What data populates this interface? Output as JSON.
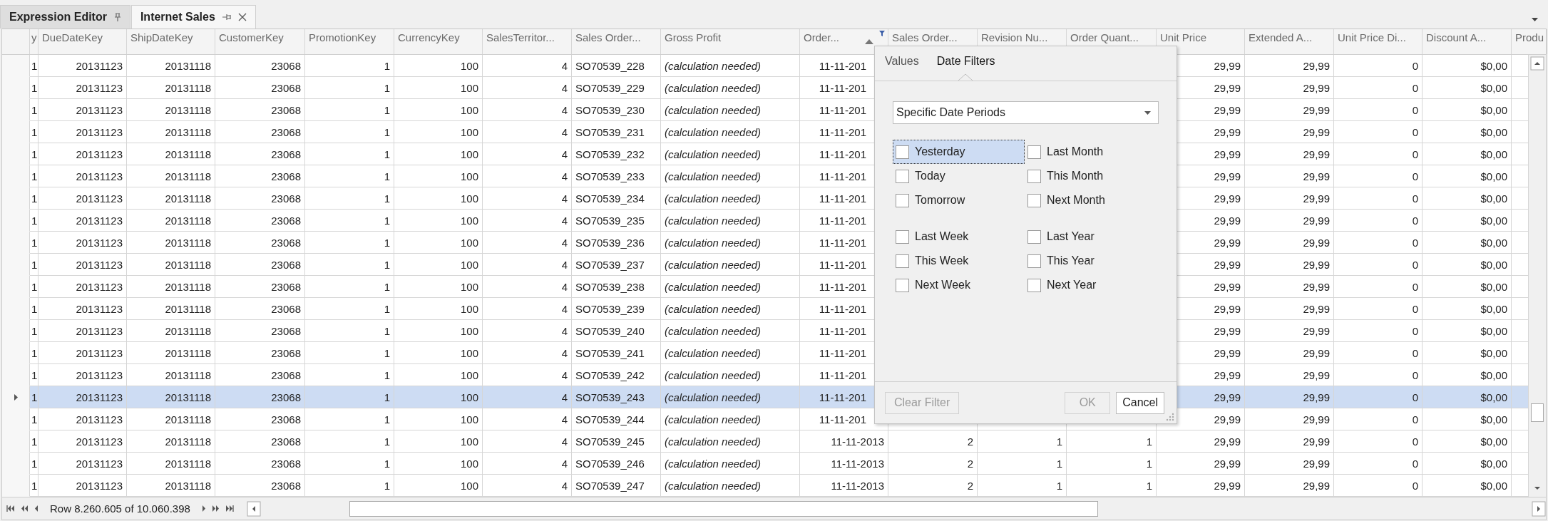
{
  "tabs": [
    {
      "label": "Expression Editor",
      "selected": false,
      "pinned": true
    },
    {
      "label": "Internet Sales",
      "selected": true,
      "pinned": false
    }
  ],
  "grid": {
    "columns": [
      {
        "label": "y",
        "kind": "number"
      },
      {
        "label": "DueDateKey",
        "kind": "number"
      },
      {
        "label": "ShipDateKey",
        "kind": "number"
      },
      {
        "label": "CustomerKey",
        "kind": "number"
      },
      {
        "label": "PromotionKey",
        "kind": "number"
      },
      {
        "label": "CurrencyKey",
        "kind": "number"
      },
      {
        "label": "SalesTerritor...",
        "kind": "number"
      },
      {
        "label": "Sales Order...",
        "kind": "text"
      },
      {
        "label": "Gross Profit",
        "kind": "note"
      },
      {
        "label": "Order...",
        "kind": "date",
        "sorted_ascending": true,
        "filtered": true
      },
      {
        "label": "Sales Order...",
        "kind": "number"
      },
      {
        "label": "Revision Nu...",
        "kind": "number"
      },
      {
        "label": "Order Quant...",
        "kind": "number"
      },
      {
        "label": "Unit Price",
        "kind": "number"
      },
      {
        "label": "Extended A...",
        "kind": "number"
      },
      {
        "label": "Unit Price Di...",
        "kind": "number"
      },
      {
        "label": "Discount A...",
        "kind": "number"
      },
      {
        "label": "Produ",
        "kind": "text"
      }
    ],
    "rows": [
      {
        "selected": false,
        "cells": [
          "1",
          "20131123",
          "20131118",
          "23068",
          "1",
          "100",
          "4",
          "SO70539_228",
          "(calculation needed)",
          "11-11-201"
        ],
        "tail": [
          "29,99",
          "29,99",
          "0",
          "$0,00"
        ]
      },
      {
        "selected": false,
        "cells": [
          "1",
          "20131123",
          "20131118",
          "23068",
          "1",
          "100",
          "4",
          "SO70539_229",
          "(calculation needed)",
          "11-11-201"
        ],
        "tail": [
          "29,99",
          "29,99",
          "0",
          "$0,00"
        ]
      },
      {
        "selected": false,
        "cells": [
          "1",
          "20131123",
          "20131118",
          "23068",
          "1",
          "100",
          "4",
          "SO70539_230",
          "(calculation needed)",
          "11-11-201"
        ],
        "tail": [
          "29,99",
          "29,99",
          "0",
          "$0,00"
        ]
      },
      {
        "selected": false,
        "cells": [
          "1",
          "20131123",
          "20131118",
          "23068",
          "1",
          "100",
          "4",
          "SO70539_231",
          "(calculation needed)",
          "11-11-201"
        ],
        "tail": [
          "29,99",
          "29,99",
          "0",
          "$0,00"
        ]
      },
      {
        "selected": false,
        "cells": [
          "1",
          "20131123",
          "20131118",
          "23068",
          "1",
          "100",
          "4",
          "SO70539_232",
          "(calculation needed)",
          "11-11-201"
        ],
        "tail": [
          "29,99",
          "29,99",
          "0",
          "$0,00"
        ]
      },
      {
        "selected": false,
        "cells": [
          "1",
          "20131123",
          "20131118",
          "23068",
          "1",
          "100",
          "4",
          "SO70539_233",
          "(calculation needed)",
          "11-11-201"
        ],
        "tail": [
          "29,99",
          "29,99",
          "0",
          "$0,00"
        ]
      },
      {
        "selected": false,
        "cells": [
          "1",
          "20131123",
          "20131118",
          "23068",
          "1",
          "100",
          "4",
          "SO70539_234",
          "(calculation needed)",
          "11-11-201"
        ],
        "tail": [
          "29,99",
          "29,99",
          "0",
          "$0,00"
        ]
      },
      {
        "selected": false,
        "cells": [
          "1",
          "20131123",
          "20131118",
          "23068",
          "1",
          "100",
          "4",
          "SO70539_235",
          "(calculation needed)",
          "11-11-201"
        ],
        "tail": [
          "29,99",
          "29,99",
          "0",
          "$0,00"
        ]
      },
      {
        "selected": false,
        "cells": [
          "1",
          "20131123",
          "20131118",
          "23068",
          "1",
          "100",
          "4",
          "SO70539_236",
          "(calculation needed)",
          "11-11-201"
        ],
        "tail": [
          "29,99",
          "29,99",
          "0",
          "$0,00"
        ]
      },
      {
        "selected": false,
        "cells": [
          "1",
          "20131123",
          "20131118",
          "23068",
          "1",
          "100",
          "4",
          "SO70539_237",
          "(calculation needed)",
          "11-11-201"
        ],
        "tail": [
          "29,99",
          "29,99",
          "0",
          "$0,00"
        ]
      },
      {
        "selected": false,
        "cells": [
          "1",
          "20131123",
          "20131118",
          "23068",
          "1",
          "100",
          "4",
          "SO70539_238",
          "(calculation needed)",
          "11-11-201"
        ],
        "tail": [
          "29,99",
          "29,99",
          "0",
          "$0,00"
        ]
      },
      {
        "selected": false,
        "cells": [
          "1",
          "20131123",
          "20131118",
          "23068",
          "1",
          "100",
          "4",
          "SO70539_239",
          "(calculation needed)",
          "11-11-201"
        ],
        "tail": [
          "29,99",
          "29,99",
          "0",
          "$0,00"
        ]
      },
      {
        "selected": false,
        "cells": [
          "1",
          "20131123",
          "20131118",
          "23068",
          "1",
          "100",
          "4",
          "SO70539_240",
          "(calculation needed)",
          "11-11-201"
        ],
        "tail": [
          "29,99",
          "29,99",
          "0",
          "$0,00"
        ]
      },
      {
        "selected": false,
        "cells": [
          "1",
          "20131123",
          "20131118",
          "23068",
          "1",
          "100",
          "4",
          "SO70539_241",
          "(calculation needed)",
          "11-11-201"
        ],
        "tail": [
          "29,99",
          "29,99",
          "0",
          "$0,00"
        ]
      },
      {
        "selected": false,
        "cells": [
          "1",
          "20131123",
          "20131118",
          "23068",
          "1",
          "100",
          "4",
          "SO70539_242",
          "(calculation needed)",
          "11-11-201"
        ],
        "tail": [
          "29,99",
          "29,99",
          "0",
          "$0,00"
        ]
      },
      {
        "selected": true,
        "cells": [
          "1",
          "20131123",
          "20131118",
          "23068",
          "1",
          "100",
          "4",
          "SO70539_243",
          "(calculation needed)",
          "11-11-201"
        ],
        "tail": [
          "29,99",
          "29,99",
          "0",
          "$0,00"
        ]
      },
      {
        "selected": false,
        "cells": [
          "1",
          "20131123",
          "20131118",
          "23068",
          "1",
          "100",
          "4",
          "SO70539_244",
          "(calculation needed)",
          "11-11-201"
        ],
        "tail": [
          "29,99",
          "29,99",
          "0",
          "$0,00"
        ]
      },
      {
        "selected": false,
        "cells": [
          "1",
          "20131123",
          "20131118",
          "23068",
          "1",
          "100",
          "4",
          "SO70539_245",
          "(calculation needed)",
          "11-11-2013"
        ],
        "middle": [
          "2",
          "1",
          "1"
        ],
        "tail": [
          "29,99",
          "29,99",
          "0",
          "$0,00"
        ]
      },
      {
        "selected": false,
        "cells": [
          "1",
          "20131123",
          "20131118",
          "23068",
          "1",
          "100",
          "4",
          "SO70539_246",
          "(calculation needed)",
          "11-11-2013"
        ],
        "middle": [
          "2",
          "1",
          "1"
        ],
        "tail": [
          "29,99",
          "29,99",
          "0",
          "$0,00"
        ]
      },
      {
        "selected": false,
        "cells": [
          "1",
          "20131123",
          "20131118",
          "23068",
          "1",
          "100",
          "4",
          "SO70539_247",
          "(calculation needed)",
          "11-11-2013"
        ],
        "middle": [
          "2",
          "1",
          "1"
        ],
        "tail": [
          "29,99",
          "29,99",
          "0",
          "$0,00"
        ]
      }
    ],
    "navigator": {
      "text": "Row 8.260.605 of 10.060.398"
    }
  },
  "filter_popup": {
    "tabs": [
      {
        "label": "Values",
        "selected": false
      },
      {
        "label": "Date Filters",
        "selected": true
      }
    ],
    "dropdown": {
      "value": "Specific Date Periods"
    },
    "periods": [
      {
        "items": [
          {
            "label": "Yesterday",
            "checked": false,
            "focused": true
          },
          {
            "label": "Today",
            "checked": false,
            "focused": false
          },
          {
            "label": "Tomorrow",
            "checked": false,
            "focused": false
          },
          {
            "label": "Last Month",
            "checked": false,
            "focused": false
          },
          {
            "label": "This Month",
            "checked": false,
            "focused": false
          },
          {
            "label": "Next Month",
            "checked": false,
            "focused": false
          }
        ]
      },
      {
        "items": [
          {
            "label": "Last Week",
            "checked": false,
            "focused": false
          },
          {
            "label": "This Week",
            "checked": false,
            "focused": false
          },
          {
            "label": "Next Week",
            "checked": false,
            "focused": false
          },
          {
            "label": "Last Year",
            "checked": false,
            "focused": false
          },
          {
            "label": "This Year",
            "checked": false,
            "focused": false
          },
          {
            "label": "Next Year",
            "checked": false,
            "focused": false
          }
        ]
      }
    ],
    "buttons": [
      {
        "label": "Clear Filter",
        "disabled": true
      },
      {
        "label": "OK",
        "disabled": true
      },
      {
        "label": "Cancel",
        "disabled": false
      }
    ]
  }
}
